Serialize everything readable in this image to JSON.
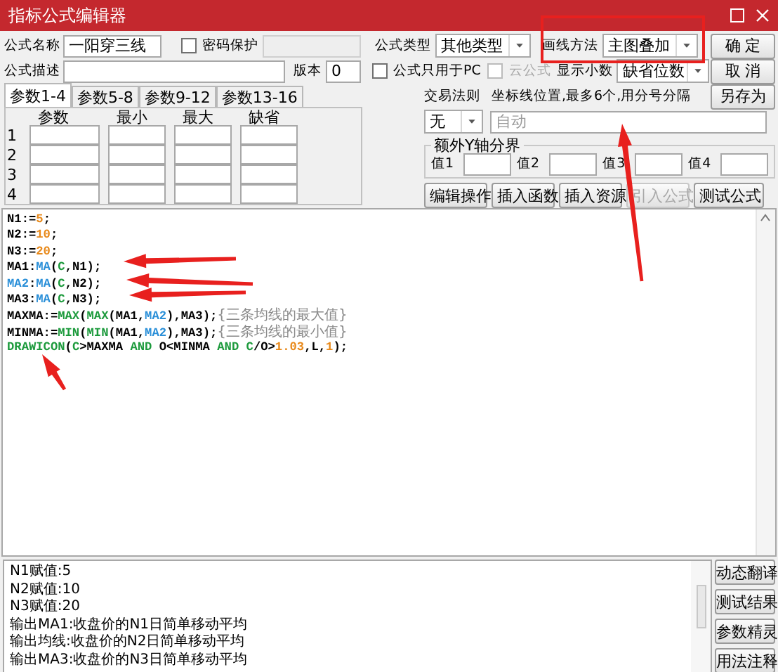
{
  "window": {
    "title": "指标公式编辑器"
  },
  "form": {
    "name_label": "公式名称",
    "name_value": "一阳穿三线",
    "password": {
      "label": "密码保护",
      "checked": false
    },
    "desc_label": "公式描述",
    "version_label": "版本",
    "version_value": "0",
    "type_label": "公式类型",
    "type_value": "其他类型",
    "draw_label": "画线方法",
    "draw_value": "主图叠加",
    "pc_only": {
      "label": "公式只用于PC",
      "checked": false
    },
    "cloud": {
      "label": "云公式",
      "checked": false,
      "disabled": true
    },
    "decimals_label": "显示小数",
    "decimals_value": "缺省位数",
    "trade_label": "交易法则",
    "trade_value": "无",
    "axis_label": "坐标线位置,最多6个,用分号分隔",
    "axis_placeholder": "自动",
    "yaxis_group": "额外Y轴分界",
    "yaxis_values": [
      "值1",
      "值2",
      "值3",
      "值4"
    ]
  },
  "param_tabs": [
    {
      "label": "参数1-4",
      "selected": true
    },
    {
      "label": "参数5-8",
      "selected": false
    },
    {
      "label": "参数9-12",
      "selected": false
    },
    {
      "label": "参数13-16",
      "selected": false
    }
  ],
  "param_table": {
    "columns": [
      "参数",
      "最小",
      "最大",
      "缺省"
    ],
    "rows": [
      "1",
      "2",
      "3",
      "4"
    ]
  },
  "side_buttons": [
    "确 定",
    "取 消",
    "另存为"
  ],
  "action_buttons": [
    {
      "label": "编辑操作",
      "disabled": false
    },
    {
      "label": "插入函数",
      "disabled": false
    },
    {
      "label": "插入资源",
      "disabled": false
    },
    {
      "label": "引入公式",
      "disabled": true
    },
    {
      "label": "测试公式",
      "disabled": false
    }
  ],
  "code_lines": [
    [
      {
        "text": "N1:=",
        "kind": "plain"
      },
      {
        "text": "5",
        "kind": "number"
      },
      {
        "text": ";",
        "kind": "plain"
      }
    ],
    [
      {
        "text": "N2:=",
        "kind": "plain"
      },
      {
        "text": "10",
        "kind": "number"
      },
      {
        "text": ";",
        "kind": "plain"
      }
    ],
    [
      {
        "text": "N3:=",
        "kind": "plain"
      },
      {
        "text": "20",
        "kind": "number"
      },
      {
        "text": ";",
        "kind": "plain"
      }
    ],
    [
      {
        "text": "MA1:",
        "kind": "plain"
      },
      {
        "text": "MA",
        "kind": "call"
      },
      {
        "text": "(",
        "kind": "plain"
      },
      {
        "text": "C",
        "kind": "builtin"
      },
      {
        "text": ",N1);",
        "kind": "plain"
      }
    ],
    [
      {
        "text": "MA2",
        "kind": "ref"
      },
      {
        "text": ":",
        "kind": "plain"
      },
      {
        "text": "MA",
        "kind": "call"
      },
      {
        "text": "(",
        "kind": "plain"
      },
      {
        "text": "C",
        "kind": "builtin"
      },
      {
        "text": ",N2);",
        "kind": "plain"
      }
    ],
    [
      {
        "text": "MA3:",
        "kind": "plain"
      },
      {
        "text": "MA",
        "kind": "call"
      },
      {
        "text": "(",
        "kind": "plain"
      },
      {
        "text": "C",
        "kind": "builtin"
      },
      {
        "text": ",N3);",
        "kind": "plain"
      }
    ],
    [
      {
        "text": "MAXMA:=",
        "kind": "plain"
      },
      {
        "text": "MAX",
        "kind": "builtin"
      },
      {
        "text": "(",
        "kind": "plain"
      },
      {
        "text": "MAX",
        "kind": "builtin"
      },
      {
        "text": "(MA1,",
        "kind": "plain"
      },
      {
        "text": "MA2",
        "kind": "ref"
      },
      {
        "text": "),MA3);",
        "kind": "plain"
      },
      {
        "text": "{三条均线的最大值}",
        "kind": "comment"
      }
    ],
    [
      {
        "text": "MINMA:=",
        "kind": "plain"
      },
      {
        "text": "MIN",
        "kind": "builtin"
      },
      {
        "text": "(",
        "kind": "plain"
      },
      {
        "text": "MIN",
        "kind": "builtin"
      },
      {
        "text": "(MA1,",
        "kind": "plain"
      },
      {
        "text": "MA2",
        "kind": "ref"
      },
      {
        "text": "),MA3);",
        "kind": "plain"
      },
      {
        "text": "{三条均线的最小值}",
        "kind": "comment"
      }
    ],
    [
      {
        "text": "DRAWICON",
        "kind": "builtin"
      },
      {
        "text": "(",
        "kind": "plain"
      },
      {
        "text": "C",
        "kind": "builtin"
      },
      {
        "text": ">MAXMA ",
        "kind": "plain"
      },
      {
        "text": "AND",
        "kind": "builtin"
      },
      {
        "text": " O<MINMA ",
        "kind": "plain"
      },
      {
        "text": "AND",
        "kind": "builtin"
      },
      {
        "text": " C",
        "kind": "builtin"
      },
      {
        "text": "/O>",
        "kind": "plain"
      },
      {
        "text": "1.03",
        "kind": "number"
      },
      {
        "text": ",L,",
        "kind": "plain"
      },
      {
        "text": "1",
        "kind": "number"
      },
      {
        "text": ");",
        "kind": "plain"
      }
    ]
  ],
  "output_lines": [
    "N1赋值:5",
    "N2赋值:10",
    "N3赋值:20",
    "输出MA1:收盘价的N1日简单移动平均",
    "输出均线:收盘价的N2日简单移动平均",
    "输出MA3:收盘价的N3日简单移动平均"
  ],
  "output_buttons": [
    "动态翻译",
    "测试结果",
    "参数精灵",
    "用法注释"
  ]
}
